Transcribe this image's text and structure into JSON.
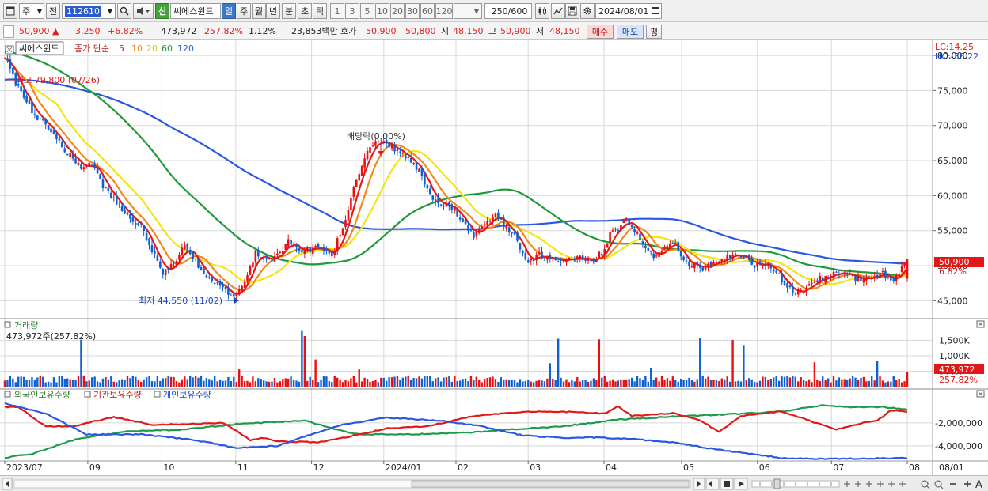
{
  "toolbar": {
    "period_selector": "주",
    "prev_label": "전",
    "code": "112610",
    "new_badge": "신",
    "stock_name": "씨에스윈드",
    "tabs": [
      "일",
      "주",
      "월",
      "년",
      "분",
      "초",
      "틱"
    ],
    "active_tab": "일",
    "intervals": [
      "1",
      "3",
      "5",
      "10",
      "20",
      "30",
      "60",
      "120"
    ],
    "count_value": "250",
    "count_total": "/600",
    "date": "2024/08/01"
  },
  "quote": {
    "price": "50,900",
    "arrow": "▲",
    "change": "3,250",
    "change_pct": "+6.82%",
    "volume": "473,972",
    "volume_ratio": "257.82%",
    "turnover_pct": "1.12%",
    "amount": "23,853백만",
    "hoga_label": "호가",
    "ask": "50,900",
    "bid": "50,800",
    "open_label": "시",
    "open": "48,150",
    "high_label": "고",
    "high": "50,900",
    "low_label": "저",
    "low": "48,150",
    "buy_label": "매수",
    "sell_label": "매도",
    "eval_label": "평"
  },
  "colors": {
    "candle_up": "#e81010",
    "candle_down": "#1060d0",
    "ma5": "#e81818",
    "ma10": "#f08a18",
    "ma20": "#f4e414",
    "ma60": "#1f9a3a",
    "ma120": "#2a58e0",
    "foreign": "#1f9a4a",
    "institution": "#e01818",
    "individual": "#2a58e0"
  },
  "price_panel": {
    "legend_name": "씨에스윈드",
    "legend_indicator": "종가 단순",
    "ma_periods": [
      "5",
      "10",
      "20",
      "60",
      "120"
    ],
    "lc_label": "LC:14.25",
    "hc_label": "HC:-36.22",
    "high_annotation": "최고 79,800 (07/26)",
    "low_annotation": "최저 44,550 (11/02)",
    "dividend_annotation": "배당락(0.00%)",
    "last_price_tag": "50,900",
    "last_pct_tag": "6.82%"
  },
  "volume_panel": {
    "title": "거래량",
    "info": "473,972주(257.82%)",
    "last_tag": "473,972",
    "last_pct_tag": "257.82%"
  },
  "flow_panel": {
    "legend": [
      "외국인보유수량",
      "기관보유수량",
      "개인보유수량"
    ]
  },
  "x_axis": {
    "labels": [
      "2023/07",
      "09",
      "10",
      "11",
      "12",
      "2024/01",
      "02",
      "03",
      "04",
      "05",
      "06",
      "07",
      "08"
    ],
    "right_label": "08/01"
  },
  "chart_data": {
    "type": "candlestick",
    "price_axis_ticks": [
      "80,000",
      "75,000",
      "70,000",
      "65,000",
      "60,000",
      "55,000",
      "50,000",
      "45,000"
    ],
    "price_ylim": [
      42900,
      81700
    ],
    "volume_axis_ticks": [
      "1,500K",
      "1,000K",
      "500K"
    ],
    "volume_ylim": [
      0,
      2100000
    ],
    "flow_axis_ticks": [
      "-2,000,000",
      "-4,000,000"
    ],
    "flow_ylim": [
      -5250000,
      750000
    ],
    "close_waypoints": [
      [
        0,
        79800
      ],
      [
        4,
        76000
      ],
      [
        10,
        72000
      ],
      [
        16,
        69500
      ],
      [
        22,
        66500
      ],
      [
        28,
        63800
      ],
      [
        32,
        64500
      ],
      [
        36,
        61500
      ],
      [
        42,
        58500
      ],
      [
        50,
        55500
      ],
      [
        55,
        51500
      ],
      [
        58,
        49000
      ],
      [
        62,
        50500
      ],
      [
        66,
        52800
      ],
      [
        72,
        49500
      ],
      [
        76,
        47800
      ],
      [
        80,
        47200
      ],
      [
        82,
        46200
      ],
      [
        84,
        45500
      ],
      [
        88,
        47500
      ],
      [
        92,
        51800
      ],
      [
        96,
        50500
      ],
      [
        100,
        51500
      ],
      [
        104,
        53500
      ],
      [
        108,
        52000
      ],
      [
        114,
        52500
      ],
      [
        120,
        51500
      ],
      [
        124,
        55500
      ],
      [
        127,
        59500
      ],
      [
        130,
        63500
      ],
      [
        133,
        66500
      ],
      [
        136,
        68000
      ],
      [
        140,
        67500
      ],
      [
        144,
        66000
      ],
      [
        148,
        65500
      ],
      [
        152,
        63500
      ],
      [
        156,
        60000
      ],
      [
        160,
        59000
      ],
      [
        165,
        58000
      ],
      [
        168,
        56000
      ],
      [
        172,
        54200
      ],
      [
        176,
        56000
      ],
      [
        180,
        57000
      ],
      [
        184,
        55500
      ],
      [
        188,
        53500
      ],
      [
        190,
        52000
      ],
      [
        192,
        50500
      ],
      [
        196,
        51500
      ],
      [
        200,
        51000
      ],
      [
        205,
        50500
      ],
      [
        210,
        51200
      ],
      [
        215,
        50800
      ],
      [
        220,
        52000
      ],
      [
        222,
        54500
      ],
      [
        225,
        55200
      ],
      [
        228,
        56500
      ],
      [
        231,
        55000
      ],
      [
        234,
        53000
      ],
      [
        238,
        51000
      ],
      [
        242,
        52500
      ],
      [
        246,
        53000
      ],
      [
        250,
        50500
      ],
      [
        255,
        49500
      ],
      [
        260,
        50500
      ],
      [
        264,
        51000
      ],
      [
        268,
        51800
      ],
      [
        272,
        51000
      ],
      [
        275,
        50000
      ],
      [
        278,
        50500
      ],
      [
        282,
        49500
      ],
      [
        286,
        47500
      ],
      [
        290,
        46200
      ],
      [
        294,
        46800
      ],
      [
        298,
        48000
      ],
      [
        302,
        48500
      ],
      [
        306,
        49000
      ],
      [
        310,
        48500
      ],
      [
        314,
        48000
      ],
      [
        318,
        48500
      ],
      [
        322,
        49000
      ],
      [
        326,
        47800
      ],
      [
        331,
        50900
      ]
    ],
    "volume_base": 250000,
    "volume_spikes": [
      [
        28,
        1520000
      ],
      [
        86,
        560000
      ],
      [
        109,
        1800000
      ],
      [
        110,
        1640000
      ],
      [
        114,
        880000
      ],
      [
        130,
        560000
      ],
      [
        200,
        760000
      ],
      [
        203,
        1550000
      ],
      [
        218,
        1530000
      ],
      [
        237,
        600000
      ],
      [
        255,
        1570000
      ],
      [
        267,
        1510000
      ],
      [
        271,
        1350000
      ],
      [
        297,
        790000
      ],
      [
        320,
        830000
      ],
      [
        331,
        474000
      ]
    ],
    "foreign_series": [
      [
        0,
        -5050000
      ],
      [
        10,
        -4700000
      ],
      [
        25,
        -3500000
      ],
      [
        45,
        -2700000
      ],
      [
        65,
        -2600000
      ],
      [
        85,
        -2100000
      ],
      [
        110,
        -1800000
      ],
      [
        122,
        -2600000
      ],
      [
        130,
        -3000000
      ],
      [
        150,
        -3000000
      ],
      [
        170,
        -2850000
      ],
      [
        190,
        -2500000
      ],
      [
        205,
        -2300000
      ],
      [
        225,
        -1700000
      ],
      [
        250,
        -1400000
      ],
      [
        270,
        -1200000
      ],
      [
        285,
        -1000000
      ],
      [
        300,
        -450000
      ],
      [
        310,
        -650000
      ],
      [
        322,
        -600000
      ],
      [
        331,
        -850000
      ]
    ],
    "institution_series": [
      [
        0,
        -600000
      ],
      [
        5,
        -600000
      ],
      [
        10,
        -1500000
      ],
      [
        15,
        -2300000
      ],
      [
        25,
        -2300000
      ],
      [
        30,
        -2000000
      ],
      [
        40,
        -1500000
      ],
      [
        55,
        -2200000
      ],
      [
        65,
        -2100000
      ],
      [
        80,
        -2000000
      ],
      [
        85,
        -2700000
      ],
      [
        90,
        -3500000
      ],
      [
        95,
        -3300000
      ],
      [
        100,
        -3600000
      ],
      [
        115,
        -3700000
      ],
      [
        125,
        -3250000
      ],
      [
        140,
        -2500000
      ],
      [
        155,
        -2300000
      ],
      [
        170,
        -1500000
      ],
      [
        180,
        -1200000
      ],
      [
        195,
        -1000000
      ],
      [
        210,
        -1050000
      ],
      [
        220,
        -1200000
      ],
      [
        225,
        -550000
      ],
      [
        230,
        -1400000
      ],
      [
        245,
        -1150000
      ],
      [
        255,
        -1750000
      ],
      [
        262,
        -2800000
      ],
      [
        270,
        -1400000
      ],
      [
        285,
        -1000000
      ],
      [
        295,
        -1800000
      ],
      [
        305,
        -2600000
      ],
      [
        315,
        -2000000
      ],
      [
        320,
        -1800000
      ],
      [
        325,
        -900000
      ],
      [
        331,
        -1000000
      ]
    ],
    "individual_series": [
      [
        0,
        -300000
      ],
      [
        15,
        -1200000
      ],
      [
        30,
        -3000000
      ],
      [
        50,
        -3000000
      ],
      [
        70,
        -3500000
      ],
      [
        85,
        -4200000
      ],
      [
        100,
        -4000000
      ],
      [
        110,
        -3200000
      ],
      [
        125,
        -2100000
      ],
      [
        140,
        -1550000
      ],
      [
        160,
        -1800000
      ],
      [
        175,
        -2300000
      ],
      [
        190,
        -3100000
      ],
      [
        205,
        -3300000
      ],
      [
        215,
        -3250000
      ],
      [
        230,
        -3400000
      ],
      [
        245,
        -3700000
      ],
      [
        262,
        -4350000
      ],
      [
        275,
        -4750000
      ],
      [
        285,
        -5050000
      ],
      [
        300,
        -5150000
      ],
      [
        331,
        -5050000
      ]
    ]
  }
}
